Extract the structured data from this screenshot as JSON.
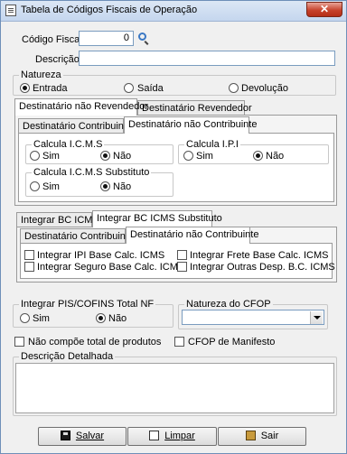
{
  "window": {
    "title": "Tabela de Códigos Fiscais de Operação",
    "close_label": "✕"
  },
  "codigo_fiscal": {
    "label": "Código Fiscal",
    "value": "0"
  },
  "descricao": {
    "label": "Descrição",
    "value": ""
  },
  "natureza": {
    "title": "Natureza",
    "options": [
      "Entrada",
      "Saída",
      "Devolução"
    ],
    "selected": "Entrada"
  },
  "tabs_destinatario": [
    "Destinatário não Revendedor",
    "Destinatário Revendedor"
  ],
  "tabs_contribuinte": [
    "Destinatário Contribuinte",
    "Destinatário não Contribuinte"
  ],
  "calc_icms": {
    "title": "Calcula I.C.M.S",
    "sim": "Sim",
    "nao": "Não",
    "selected": "Não"
  },
  "calc_ipi": {
    "title": "Calcula I.P.I",
    "sim": "Sim",
    "nao": "Não",
    "selected": "Não"
  },
  "calc_icms_st": {
    "title": "Calcula I.C.M.S Substituto",
    "sim": "Sim",
    "nao": "Não",
    "selected": "Não"
  },
  "tabs_integrar": [
    "Integrar BC ICMS",
    "Integrar BC ICMS Substituto"
  ],
  "tabs_contribuinte2": [
    "Destinatário Contribuinte",
    "Destinatário não Contribuinte"
  ],
  "checks_integrar": [
    "Integrar IPI Base Calc. ICMS",
    "Integrar Frete Base Calc. ICMS",
    "Integrar Seguro Base Calc. ICMS",
    "Integrar Outras Desp. B.C. ICMS"
  ],
  "pis_cofins": {
    "title": "Integrar PIS/COFINS Total NF",
    "sim": "Sim",
    "nao": "Não",
    "selected": "Não"
  },
  "natureza_cfop": {
    "title": "Natureza do CFOP",
    "value": ""
  },
  "check_nao_compoe": "Não compõe total de produtos",
  "check_cfop_manifesto": "CFOP de Manifesto",
  "descricao_detalhada": {
    "title": "Descrição Detalhada",
    "value": ""
  },
  "buttons": {
    "salvar": "Salvar",
    "limpar": "Limpar",
    "sair": "Sair"
  }
}
